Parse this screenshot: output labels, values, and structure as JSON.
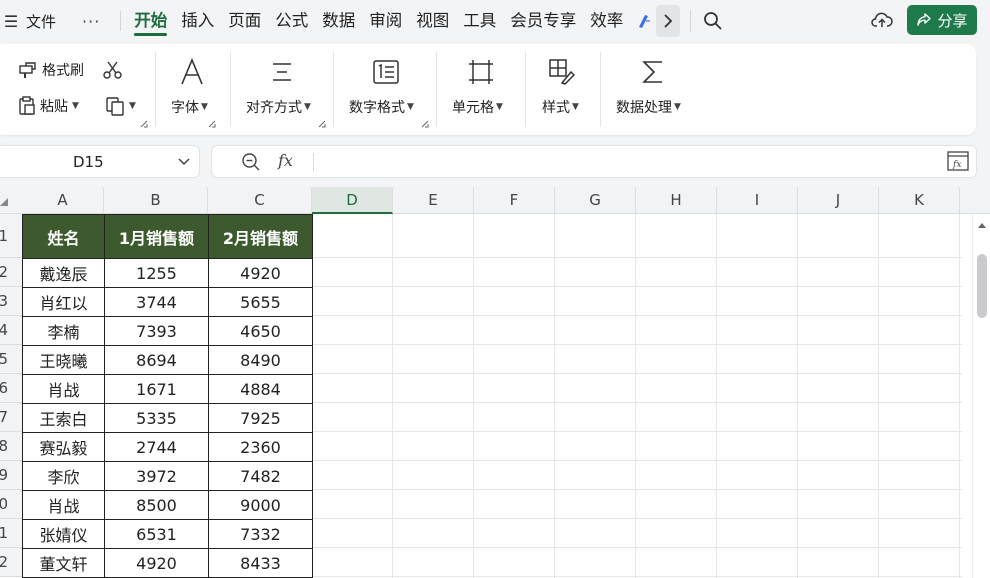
{
  "menubar": {
    "file": "文件",
    "more": "···",
    "tabs": [
      "开始",
      "插入",
      "页面",
      "公式",
      "数据",
      "审阅",
      "视图",
      "工具",
      "会员专享",
      "效率"
    ],
    "active_tab": "开始",
    "share": "分享"
  },
  "ribbon": {
    "format_painter": "格式刷",
    "paste": "粘贴",
    "font": "字体",
    "align": "对齐方式",
    "number_format": "数字格式",
    "cell": "单元格",
    "style": "样式",
    "data_process": "数据处理"
  },
  "formula_bar": {
    "name_box": "D15",
    "fx": "fx",
    "content": ""
  },
  "grid": {
    "columns": [
      "A",
      "B",
      "C",
      "D",
      "E",
      "F",
      "G",
      "H",
      "I",
      "J",
      "K"
    ],
    "selected_column": "D",
    "rows": [
      "1",
      "2",
      "3",
      "4",
      "5",
      "6",
      "7",
      "8",
      "9",
      "10",
      "11",
      "12"
    ],
    "headers": [
      "姓名",
      "1月销售额",
      "2月销售额"
    ],
    "data": [
      [
        "戴逸辰",
        "1255",
        "4920"
      ],
      [
        "肖红以",
        "3744",
        "5655"
      ],
      [
        "李楠",
        "7393",
        "4650"
      ],
      [
        "王晓曦",
        "8694",
        "8490"
      ],
      [
        "肖战",
        "1671",
        "4884"
      ],
      [
        "王索白",
        "5335",
        "7925"
      ],
      [
        "赛弘毅",
        "2744",
        "2360"
      ],
      [
        "李欣",
        "3972",
        "7482"
      ],
      [
        "肖战",
        "8500",
        "9000"
      ],
      [
        "张婧仪",
        "6531",
        "7332"
      ],
      [
        "董文轩",
        "4920",
        "8433"
      ]
    ],
    "header_color": "#3d5a2e",
    "accent_color": "#1d6d3e"
  }
}
